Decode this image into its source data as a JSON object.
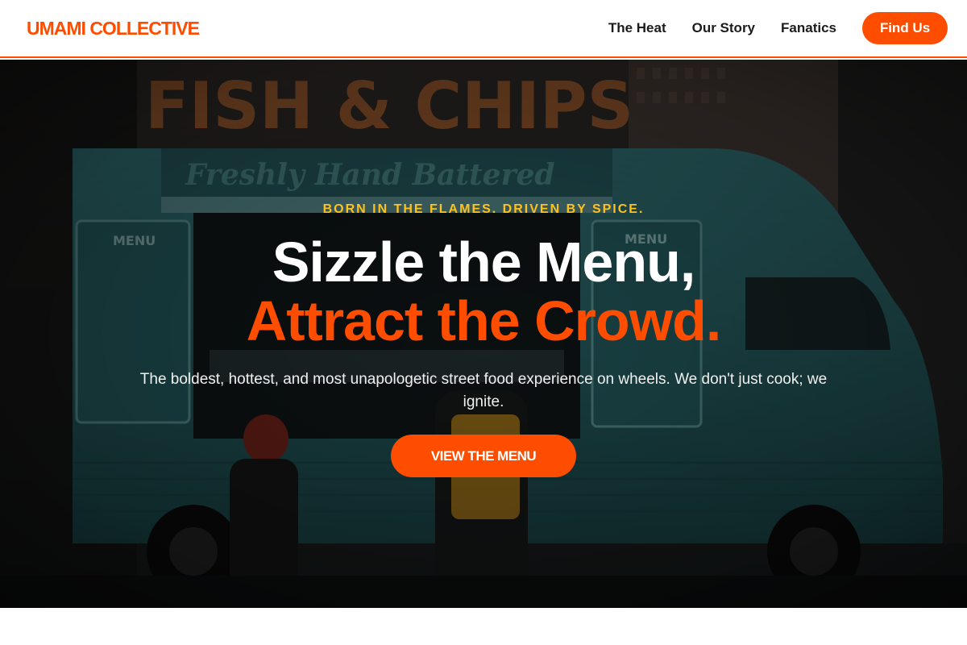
{
  "brand": {
    "name": "UMAMI COLLECTIVE"
  },
  "nav": {
    "links": [
      {
        "label": "The Heat"
      },
      {
        "label": "Our Story"
      },
      {
        "label": "Fanatics"
      }
    ],
    "cta_label": "Find Us"
  },
  "hero": {
    "eyebrow": "BORN IN THE FLAMES. DRIVEN BY SPICE.",
    "headline_line1": "Sizzle the Menu,",
    "headline_line2": "Attract the Crowd.",
    "subtext": "The boldest, hottest, and most unapologetic street food experience on wheels. We don't just cook; we ignite.",
    "cta_label": "VIEW THE MENU",
    "image": {
      "sign_text": "FISH & CHIPS",
      "banner_text": "Freshly Hand Battered",
      "menu_board_title": "MENU"
    }
  },
  "colors": {
    "accent": "#ff4d00",
    "eyebrow": "#ffc21a",
    "truck": "#2f6f74",
    "text_dark": "#1b1b1b"
  }
}
